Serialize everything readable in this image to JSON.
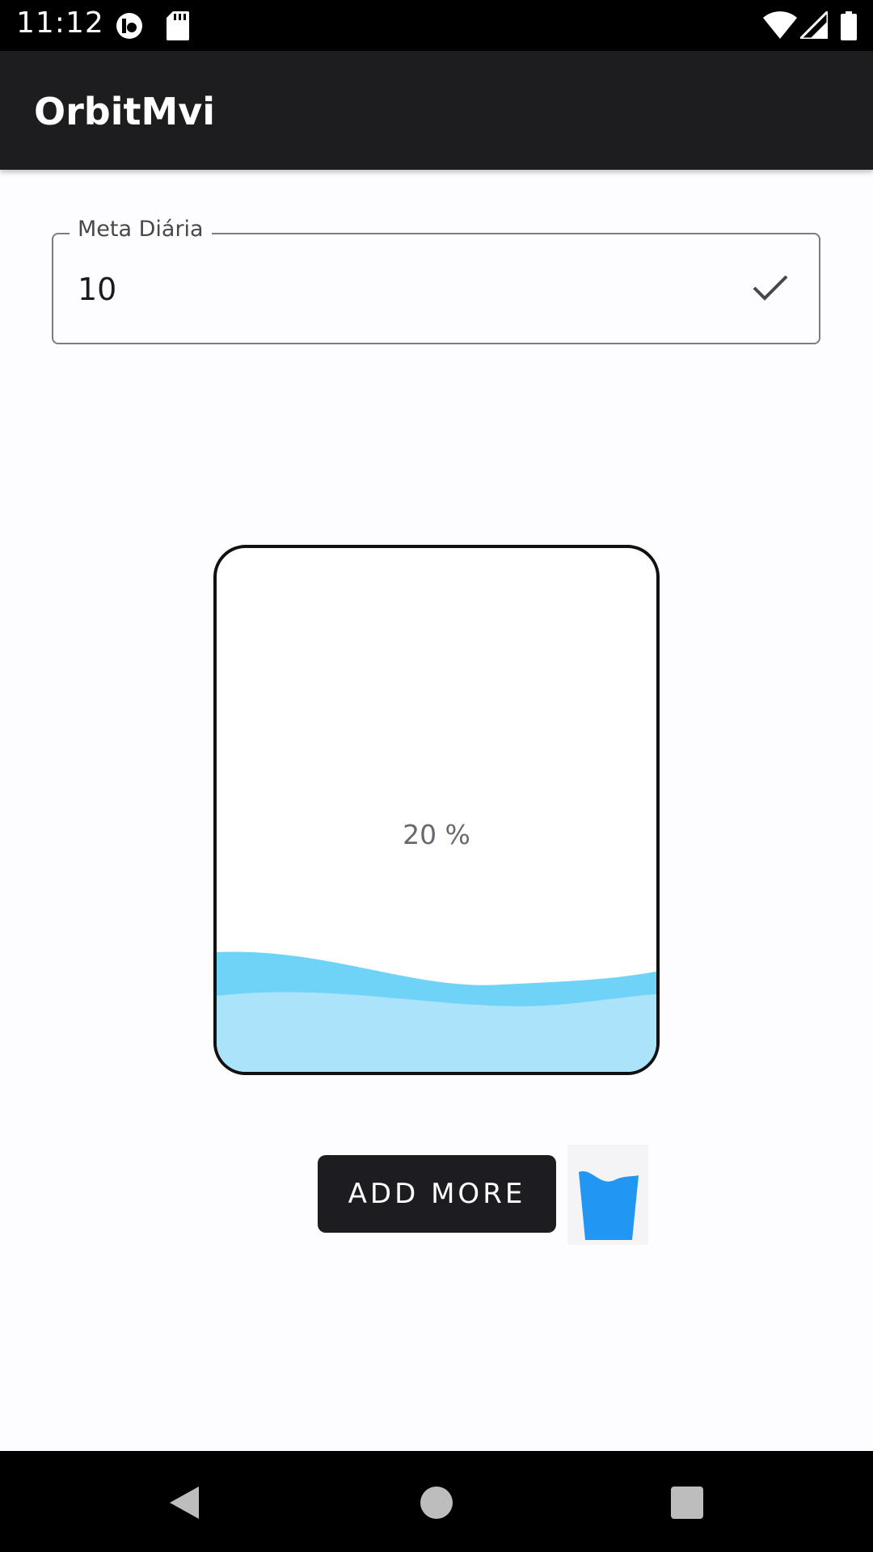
{
  "status_bar": {
    "time": "11:12",
    "icons": [
      "app-notification-icon",
      "sd-card-icon",
      "wifi-icon",
      "signal-icon",
      "battery-icon"
    ]
  },
  "app_bar": {
    "title": "OrbitMvi"
  },
  "goal_field": {
    "label": "Meta Diária",
    "value": "10",
    "trailing_icon": "check-icon"
  },
  "glass": {
    "progress_label": "20 %",
    "fill_fraction": 0.2,
    "colors": {
      "wave_back": "#6fd3f7",
      "wave_front": "#aae3fa"
    }
  },
  "actions": {
    "add_button_label": "ADD MORE",
    "cup_icon": "water-cup-icon",
    "cup_color": "#2196f3"
  },
  "nav_bar": {
    "buttons": [
      "back-icon",
      "home-icon",
      "recents-icon"
    ]
  }
}
